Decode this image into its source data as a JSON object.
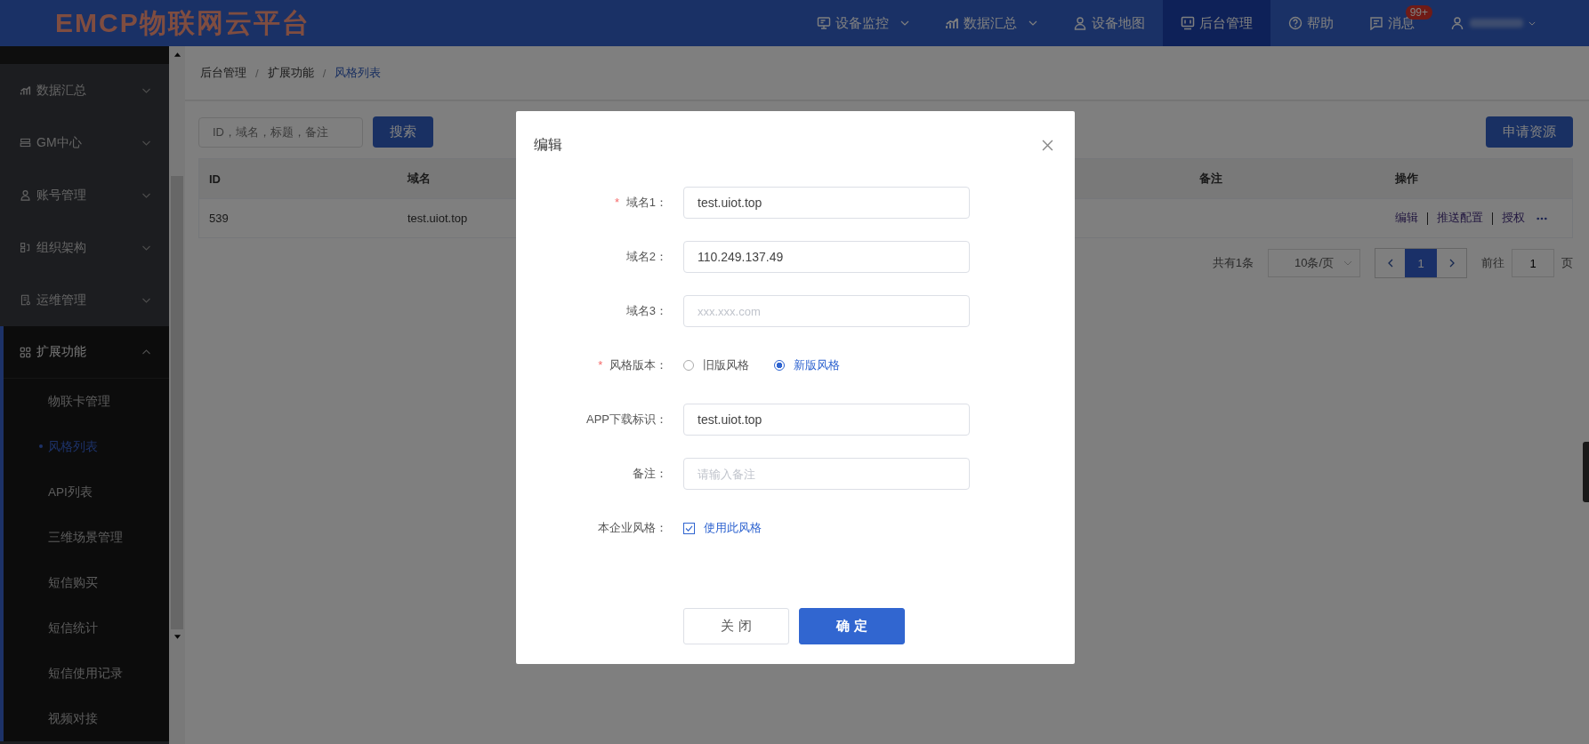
{
  "header": {
    "logo": "EMCP物联网云平台",
    "nav": [
      {
        "label": "设备监控",
        "dropdown": true,
        "selected": false
      },
      {
        "label": "数据汇总",
        "dropdown": true,
        "selected": false
      },
      {
        "label": "设备地图",
        "dropdown": false,
        "selected": false
      },
      {
        "label": "后台管理",
        "dropdown": false,
        "selected": true
      },
      {
        "label": "帮助",
        "dropdown": false,
        "selected": false
      },
      {
        "label": "消息",
        "dropdown": false,
        "selected": false,
        "badge": "99+"
      }
    ]
  },
  "sidebar": {
    "groups": [
      {
        "label": "数据汇总",
        "expanded": false
      },
      {
        "label": "GM中心",
        "expanded": false
      },
      {
        "label": "账号管理",
        "expanded": false
      },
      {
        "label": "组织架构",
        "expanded": false
      },
      {
        "label": "运维管理",
        "expanded": false
      },
      {
        "label": "扩展功能",
        "expanded": true,
        "children": [
          {
            "label": "物联卡管理",
            "selected": false
          },
          {
            "label": "风格列表",
            "selected": true
          },
          {
            "label": "API列表",
            "selected": false
          },
          {
            "label": "三维场景管理",
            "selected": false
          },
          {
            "label": "短信购买",
            "selected": false
          },
          {
            "label": "短信统计",
            "selected": false
          },
          {
            "label": "短信使用记录",
            "selected": false
          },
          {
            "label": "视频对接",
            "selected": false
          }
        ]
      }
    ]
  },
  "breadcrumb": {
    "separator": "/",
    "items": [
      "后台管理",
      "扩展功能",
      "风格列表"
    ]
  },
  "toolbar": {
    "search_placeholder": "ID，域名，标题，备注",
    "search_button": "搜索",
    "apply_button": "申请资源"
  },
  "table": {
    "columns": [
      "ID",
      "域名",
      "备注",
      "操作"
    ],
    "rows": [
      {
        "id": "539",
        "domain": "test.uiot.top",
        "actions": [
          "编辑",
          "推送配置",
          "授权"
        ]
      }
    ]
  },
  "pagination": {
    "total": "共有1条",
    "page_size": "10条/页",
    "pages": [
      {
        "label": "1",
        "selected": true
      }
    ],
    "jump_label": "前往",
    "jump_value": "1",
    "jump_suffix": "页"
  },
  "dialog": {
    "title": "编辑",
    "required_mark": "*",
    "fields": [
      {
        "kind": "input",
        "label": "域名1：",
        "required": true,
        "value": "test.uiot.top"
      },
      {
        "kind": "input",
        "label": "域名2：",
        "required": false,
        "value": "110.249.137.49"
      },
      {
        "kind": "input",
        "label": "域名3：",
        "required": false,
        "placeholder": "xxx.xxx.com"
      },
      {
        "kind": "radio",
        "label": "风格版本：",
        "required": true,
        "options": [
          {
            "label": "旧版风格",
            "selected": false
          },
          {
            "label": "新版风格",
            "selected": true
          }
        ]
      },
      {
        "kind": "input",
        "label": "APP下载标识：",
        "required": false,
        "value": "test.uiot.top"
      },
      {
        "kind": "input",
        "label": "备注：",
        "required": false,
        "placeholder": "请输入备注"
      },
      {
        "kind": "checkbox",
        "label": "本企业风格：",
        "required": false,
        "option": "使用此风格",
        "checked": true
      }
    ],
    "buttons": [
      {
        "kind": "default",
        "label": "关 闭"
      },
      {
        "kind": "primary",
        "label": "确 定"
      }
    ]
  }
}
